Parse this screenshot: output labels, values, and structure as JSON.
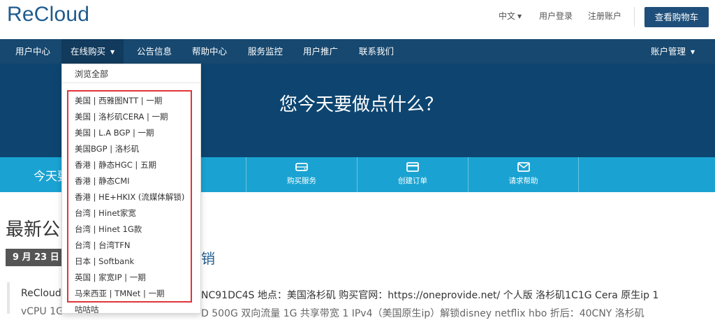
{
  "header": {
    "logo": "ReCloud",
    "language": "中文",
    "login": "用户登录",
    "register": "注册账户",
    "cart_button": "查看购物车"
  },
  "nav": {
    "items": [
      "用户中心",
      "在线购买",
      "公告信息",
      "帮助中心",
      "服务监控",
      "用户推广",
      "联系我们"
    ],
    "account": "账户管理"
  },
  "hero": {
    "title": "您今天要做点什么？"
  },
  "strip": {
    "welcome": "今天要",
    "actions": [
      {
        "label": "购买服务",
        "icon": "server-icon"
      },
      {
        "label": "创建订单",
        "icon": "credit-card-icon"
      },
      {
        "label": "请求帮助",
        "icon": "envelope-icon"
      }
    ]
  },
  "dropdown": {
    "browse_all": "浏览全部",
    "items": [
      "美国 | 西雅图NTT | 一期",
      "美国 | 洛杉矶CERA | 一期",
      "美国 | L.A BGP | 一期",
      "美国BGP | 洛杉矶",
      "香港 | 静态HGC | 五期",
      "香港 | 静态CMI",
      "香港 | HE+HKIX (流媒体解锁)",
      "台湾 | Hinet家宽",
      "台湾 | Hinet 1G款",
      "台湾 | 台湾TFN",
      "日本 | Softbank",
      "英国 | 家宽IP | 一期",
      "马来西亚 | TMNet | 一期",
      "咕咕咕"
    ],
    "highlight_color": "#e0343a"
  },
  "content": {
    "heading": "最新公",
    "date_badge": "9 月 23 日",
    "post_title": "销",
    "line1_start": "ReCloud",
    "line1": "NC91DC4S 地点：美国洛杉矶 购买官网：https://oneprovide.net/   个人版 洛杉矶1C1G Cera 原生ip 1",
    "line2_start": "vCPU 1G",
    "line2": "D 500G 双向流量 1G 共享带宽 1 IPv4（美国原生ip）解锁disney netflix hbo 折后：40CNY    洛杉矶"
  },
  "colors": {
    "brand": "#1f5b8e",
    "nav": "#17486f",
    "hero": "#0d4570",
    "strip": "#1aa3d2"
  }
}
